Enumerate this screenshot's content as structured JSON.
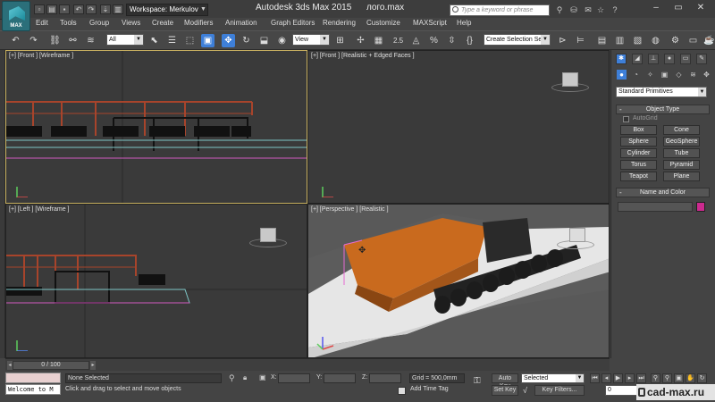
{
  "titlebar": {
    "logo_label": "MAX",
    "workspace": "Workspace: Merkulov",
    "app_title": "Autodesk 3ds Max  2015",
    "file_name": "лого.max",
    "search_placeholder": "Type a keyword or phrase"
  },
  "menu": [
    "Edit",
    "Tools",
    "Group",
    "Views",
    "Create",
    "Modifiers",
    "Animation",
    "Graph Editors",
    "Rendering",
    "Customize",
    "MAXScript",
    "Help"
  ],
  "toolbar": {
    "filter_value": "All",
    "view_value": "View",
    "spinner_label": "2.5",
    "selection_set": "Create Selection Se"
  },
  "viewports": {
    "top_left": "[+] [Front ] [Wireframe ]",
    "top_right": "[+] [Front ] [Realistic + Edged Faces ]",
    "bottom_left": "[+] [Left ] [Wireframe ]",
    "bottom_right": "[+] [Perspective ] [Realistic ]"
  },
  "command_panel": {
    "primitive_type": "Standard Primitives",
    "object_type_title": "Object Type",
    "autogrid": "AutoGrid",
    "buttons": [
      "Box",
      "Cone",
      "Sphere",
      "GeoSphere",
      "Cylinder",
      "Tube",
      "Torus",
      "Pyramid",
      "Teapot",
      "Plane"
    ],
    "name_color_title": "Name and Color",
    "object_color": "#cc2a8f"
  },
  "status": {
    "frame_counter": "0 / 100",
    "mini_listener": "Welcome to M",
    "selection": "None Selected",
    "prompt": "Click and drag to select and move objects",
    "x_label": "X:",
    "y_label": "Y:",
    "z_label": "Z:",
    "grid": "Grid = 500,0mm",
    "add_time_tag": "Add Time Tag",
    "auto_key": "Auto Key",
    "set_key": "Set Key",
    "key_mode": "Selected",
    "key_filters": "Key Filters...",
    "current_frame": "0"
  },
  "watermark": "cad-max.ru"
}
